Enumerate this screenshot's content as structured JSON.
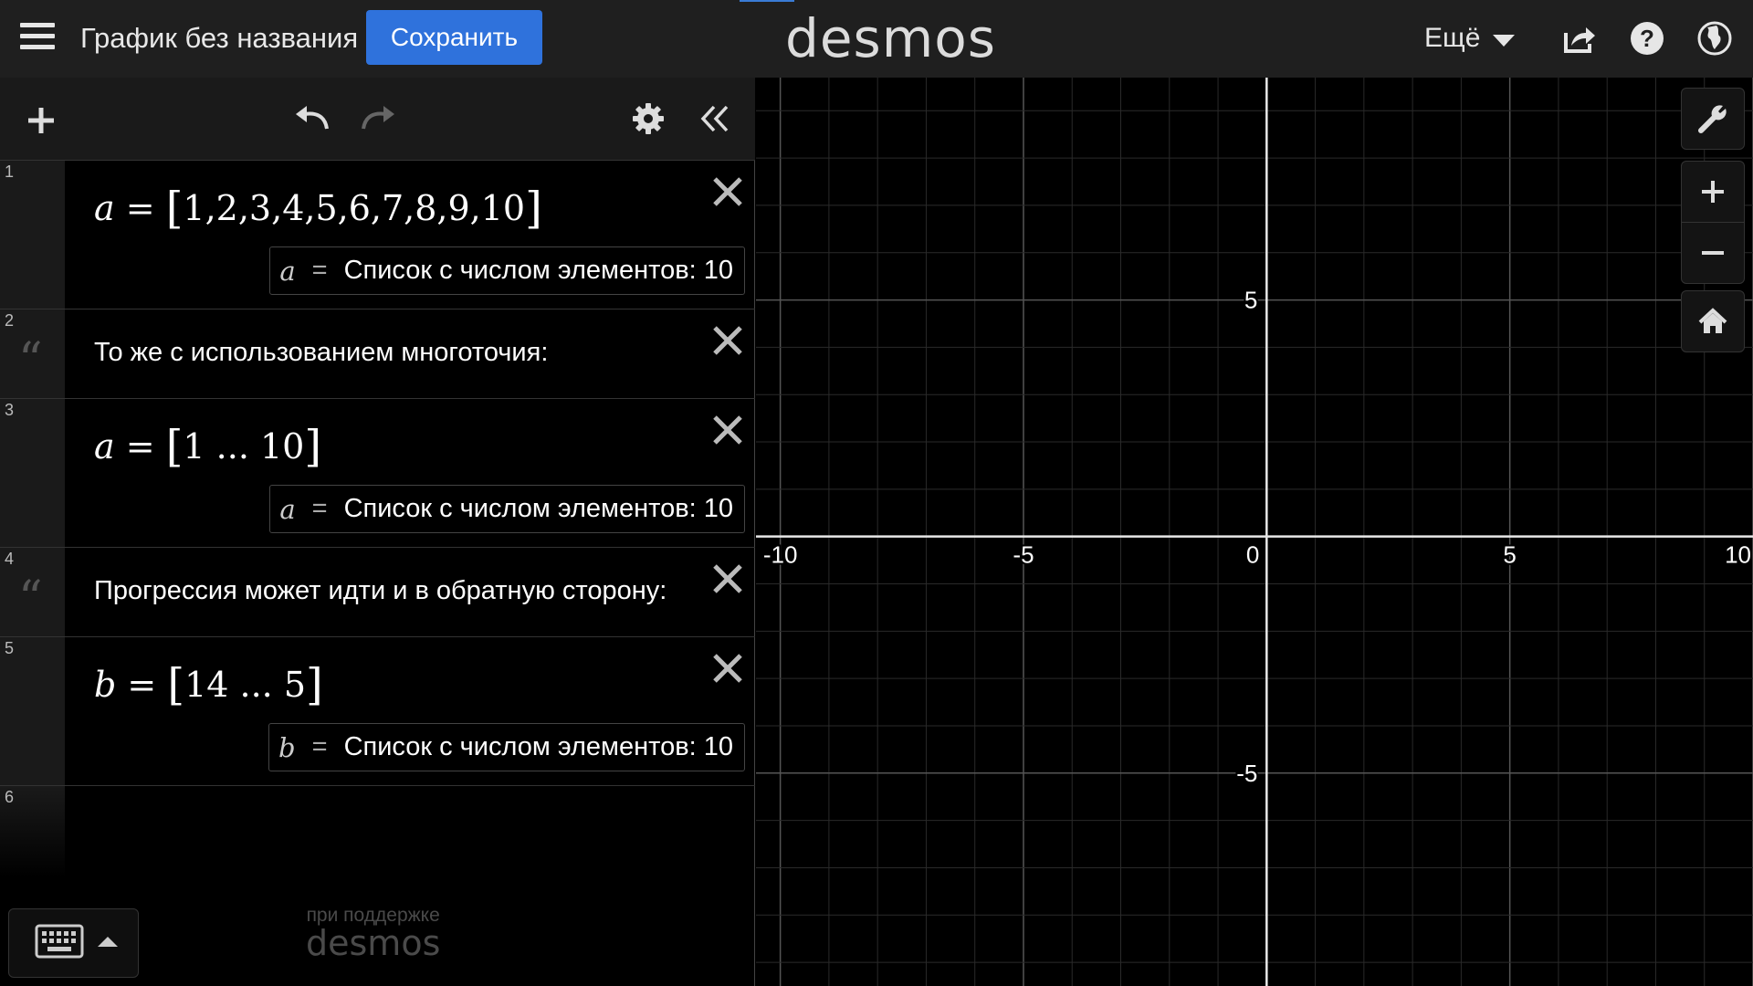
{
  "header": {
    "title": "График без названия",
    "save_label": "Сохранить",
    "logo": "desmos",
    "more_label": "Ещё",
    "icons": [
      "share-icon",
      "help-icon",
      "globe-icon"
    ],
    "accent": "#2f72dc"
  },
  "toolbar": {
    "icons": [
      "add-icon",
      "undo-icon",
      "redo-icon",
      "settings-icon",
      "collapse-icon"
    ]
  },
  "expressions": [
    {
      "num": "1",
      "type": "math",
      "var": "a",
      "eq": "=",
      "content": "1,2,3,4,5,6,7,8,9,10",
      "result": {
        "var": "a",
        "eq": "=",
        "text": "Список с числом элементов: 10"
      }
    },
    {
      "num": "2",
      "type": "note",
      "text": "То же с использованием многоточия:"
    },
    {
      "num": "3",
      "type": "math",
      "var": "a",
      "eq": "=",
      "content": "1 ... 10",
      "result": {
        "var": "a",
        "eq": "=",
        "text": "Список с числом элементов: 10"
      }
    },
    {
      "num": "4",
      "type": "note",
      "text": "Прогрессия может идти и в обратную сторону:"
    },
    {
      "num": "5",
      "type": "math",
      "var": "b",
      "eq": "=",
      "content": "14 ... 5",
      "result": {
        "var": "b",
        "eq": "=",
        "text": "Список с числом элементов: 10"
      }
    },
    {
      "num": "6",
      "type": "empty"
    }
  ],
  "footer": {
    "powered_line1": "при поддержке",
    "powered_line2": "desmos"
  },
  "graph": {
    "x_range": [
      -10.5,
      10
    ],
    "y_range": [
      -9.5,
      9.7
    ],
    "x_ticks": [
      "-10",
      "-5",
      "0",
      "5",
      "10"
    ],
    "y_ticks": [
      "5",
      "-5"
    ],
    "tool_icons": [
      "wrench-icon",
      "zoom-in-icon",
      "zoom-out-icon",
      "home-icon"
    ]
  }
}
